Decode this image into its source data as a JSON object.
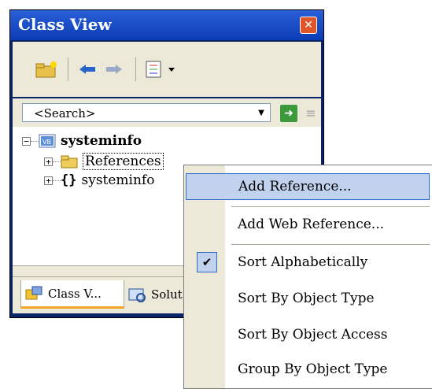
{
  "window": {
    "title": "Class View"
  },
  "search": {
    "placeholder": "<Search>"
  },
  "tree": {
    "root": "systeminfo",
    "children": [
      "References",
      "systeminfo"
    ]
  },
  "tabs": [
    "Class V...",
    "Solut"
  ],
  "context_menu": {
    "items": [
      "Add Reference...",
      "Add Web Reference...",
      "Sort Alphabetically",
      "Sort By Object Type",
      "Sort By Object Access",
      "Group By Object Type"
    ],
    "checked": "Sort Alphabetically"
  },
  "colors": {
    "titlebar": "#0a3cb5",
    "menu_highlight": "#c1d2ee",
    "tab_accent": "#f5a623"
  },
  "icons": [
    "new-folder-icon",
    "back-arrow-icon",
    "forward-arrow-icon",
    "settings-list-icon",
    "go-arrow-icon",
    "clear-search-icon",
    "close-icon"
  ]
}
